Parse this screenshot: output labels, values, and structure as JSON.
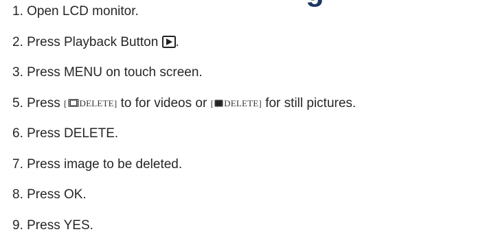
{
  "title_fragment": "g",
  "steps": [
    {
      "text": "1. Open LCD monitor."
    },
    {
      "before": "2. Press Playback Button ",
      "icon": "play-button-icon",
      "after": "."
    },
    {
      "text": "3. Press MENU on touch screen."
    },
    {
      "before": "5. Press ",
      "token1_open": "[",
      "token1_icon": "film-icon",
      "token1_label": "DELETE",
      "token1_close": "]",
      "middle": " to for videos or ",
      "token2_open": "[",
      "token2_icon": "still-picture-icon",
      "token2_label": "DELETE",
      "token2_close": "]",
      "after": " for still pictures."
    },
    {
      "text": "6. Press DELETE."
    },
    {
      "text": "7. Press image to be deleted."
    },
    {
      "text": "8. Press OK."
    },
    {
      "text": "9. Press YES."
    }
  ]
}
